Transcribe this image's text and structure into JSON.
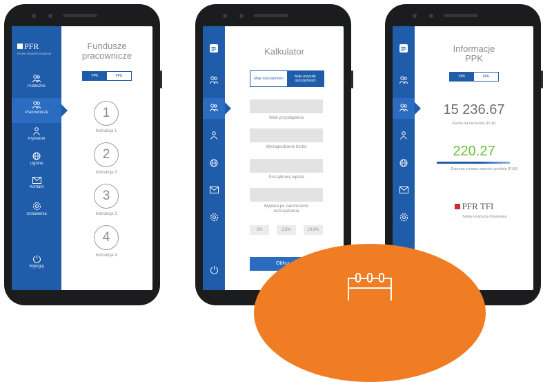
{
  "phone1": {
    "logo": "PFR",
    "logo_sub": "POLSKI FUNDUSZ ROZWOJU",
    "title_line1": "Fundusze",
    "title_line2": "pracownicze",
    "toggle": [
      "PPK",
      "PPE"
    ],
    "nav": [
      "Publiczne",
      "Pracownicze",
      "Prywatne",
      "Ogólne",
      "Kontakt",
      "Ustawienia",
      "Wyloguj"
    ],
    "steps": [
      {
        "num": "1",
        "label": "Instrukcja 1"
      },
      {
        "num": "2",
        "label": "Instrukcja 2"
      },
      {
        "num": "3",
        "label": "Instrukcja 3"
      },
      {
        "num": "4",
        "label": "Instrukcja 4"
      }
    ]
  },
  "phone2": {
    "title": "Kalkulator",
    "toggle_left": "Moje oszczędności",
    "toggle_right": "Moje przyszłe oszczędności",
    "field_labels": [
      "Wiek przystąpienia",
      "Wynagrodzenie brutto",
      "Początkowa wpłata",
      "Wypłata po zakończeniu oszczędzania"
    ],
    "pcts": [
      "2%",
      "2,5%",
      "10,0%"
    ],
    "button": "Oblicz"
  },
  "phone3": {
    "title_line1": "Informacje",
    "title_line2": "PPK",
    "toggle": [
      "PPK",
      "PPE"
    ],
    "amount": "15 236.67",
    "amount_label": "Kwota na rachunku (PLN)",
    "change": "220.27",
    "change_label": "Dzienna zmiana wartości portfela (PLN)",
    "tfi_logo": "PFR TFI",
    "tfi_label": "Twoja instytucja finansowa"
  },
  "colors": {
    "primary": "#1f5dab",
    "accent": "#f07d23",
    "green": "#6cbf3b",
    "tfi_red": "#d2282d"
  },
  "icons": [
    "calendar-icon",
    "people-icon",
    "person-icon",
    "globe-icon",
    "envelope-icon",
    "gear-icon",
    "power-icon",
    "document-icon"
  ]
}
